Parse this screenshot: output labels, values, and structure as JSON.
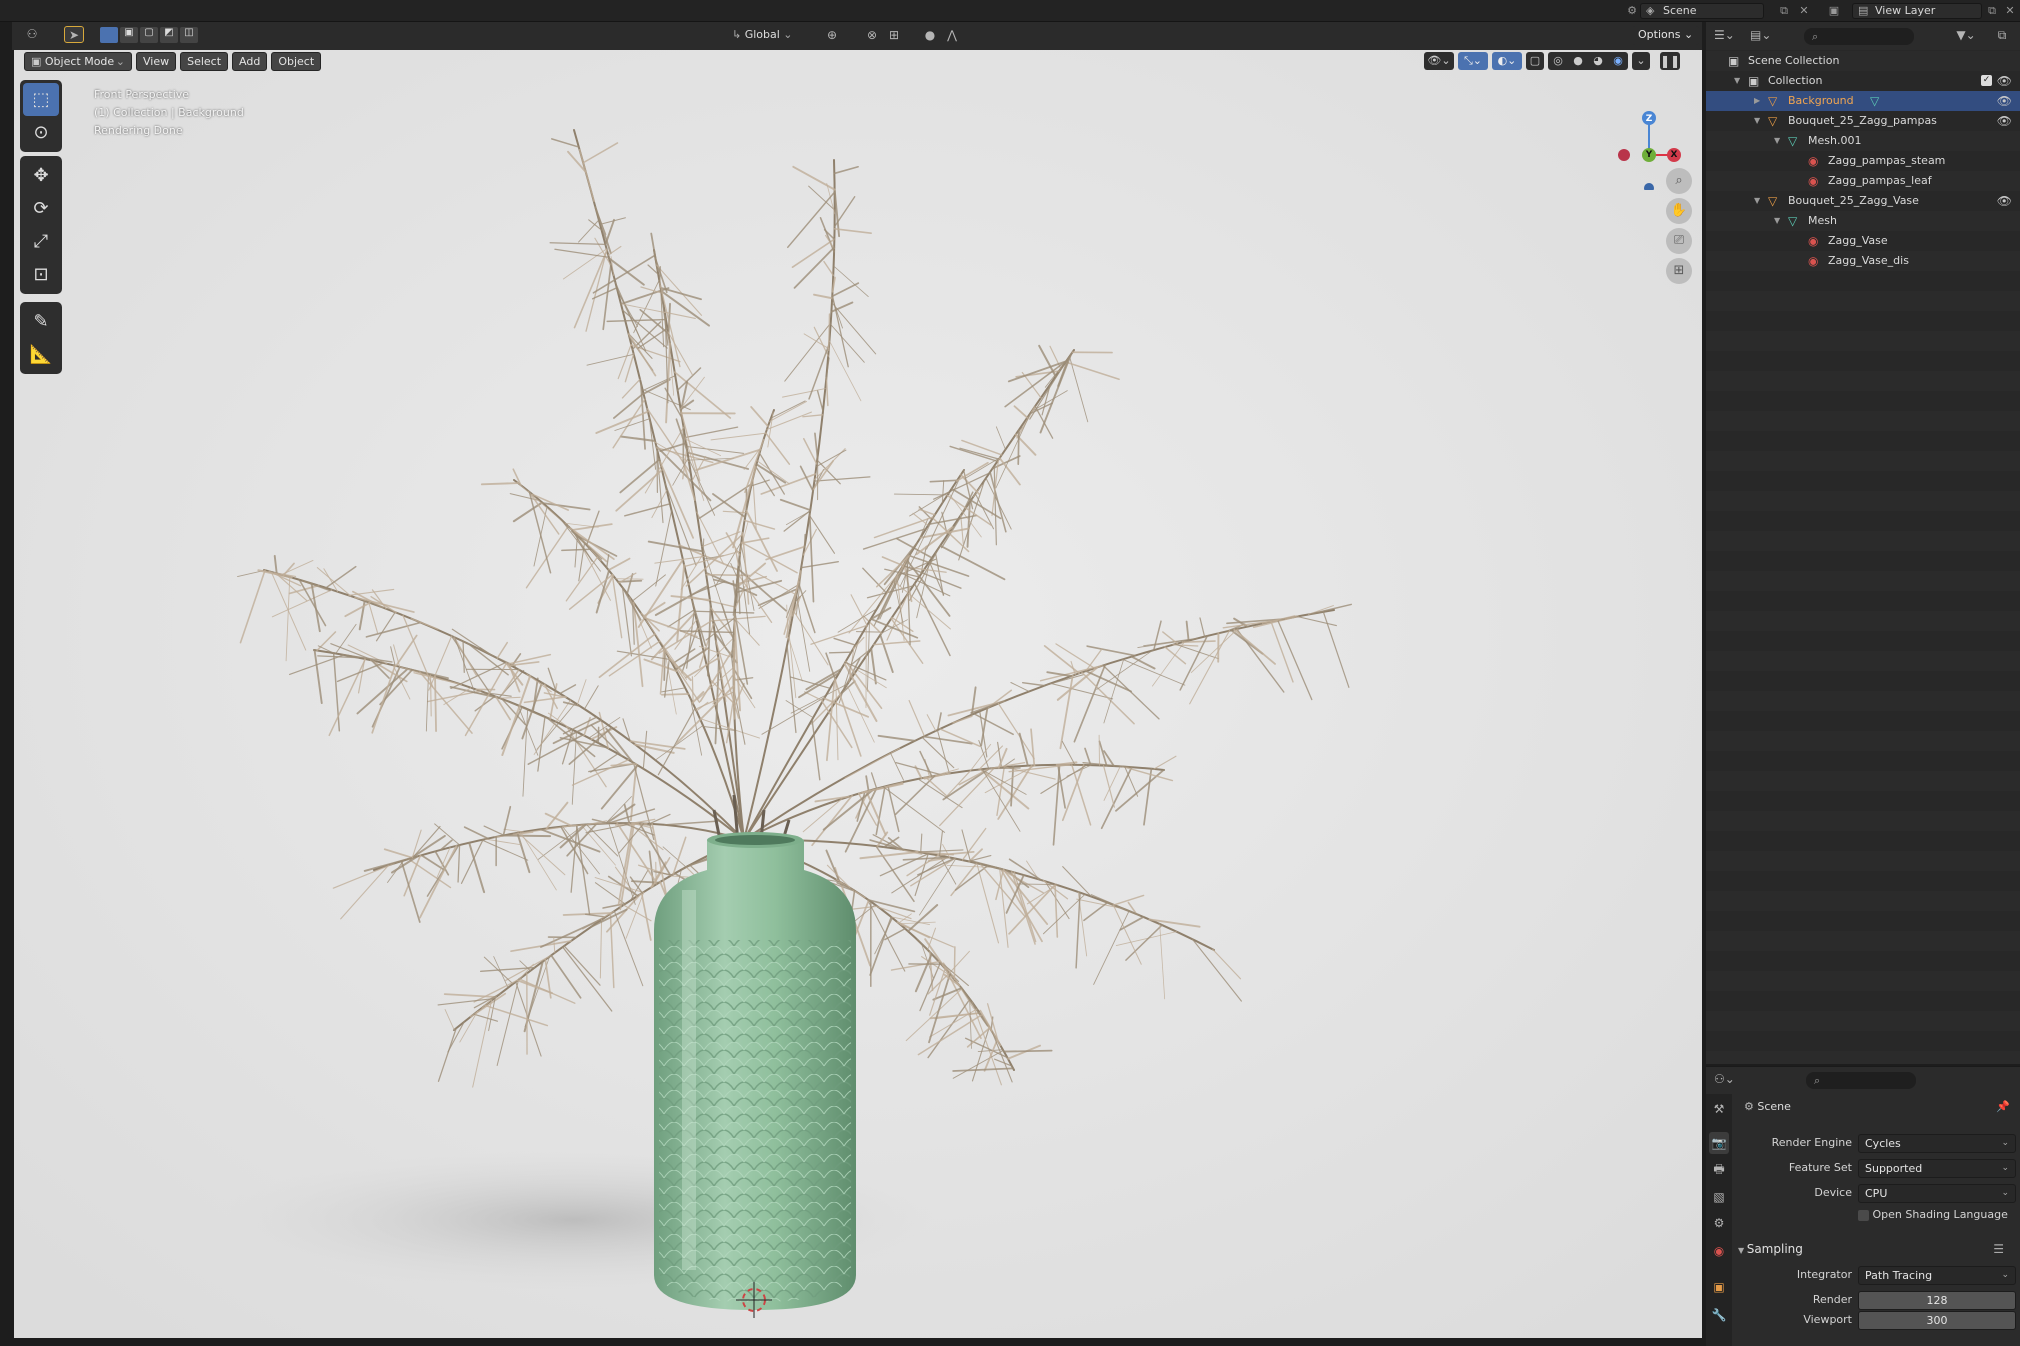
{
  "topbar": {
    "scene_name": "Scene",
    "view_layer_name": "View Layer"
  },
  "viewport_header": {
    "mode": "Object Mode",
    "menus": [
      "View",
      "Select",
      "Add",
      "Object"
    ],
    "transform_orientation": "Global",
    "options_label": "Options"
  },
  "viewport": {
    "overlay_lines": [
      "Front Perspective",
      "(1) Collection | Background",
      "Rendering Done"
    ],
    "gizmo_axes": {
      "z": "Z",
      "y": "Y",
      "x": "X"
    }
  },
  "toolbar": {
    "tools": [
      "select-box",
      "cursor",
      "move",
      "rotate",
      "scale",
      "transform",
      "annotate",
      "measure"
    ]
  },
  "outliner": {
    "root": "Scene Collection",
    "rows": [
      {
        "label": "Collection",
        "type": "collection"
      },
      {
        "label": "Background",
        "type": "object"
      },
      {
        "label": "Bouquet_25_Zagg_pampas",
        "type": "object"
      },
      {
        "label": "Mesh.001",
        "type": "mesh"
      },
      {
        "label": "Zagg_pampas_steam",
        "type": "material"
      },
      {
        "label": "Zagg_pampas_leaf",
        "type": "material"
      },
      {
        "label": "Bouquet_25_Zagg_Vase",
        "type": "object"
      },
      {
        "label": "Mesh",
        "type": "mesh"
      },
      {
        "label": "Zagg_Vase",
        "type": "material"
      },
      {
        "label": "Zagg_Vase_dis",
        "type": "material"
      }
    ]
  },
  "properties": {
    "context": "Scene",
    "render_engine_label": "Render Engine",
    "render_engine": "Cycles",
    "feature_set_label": "Feature Set",
    "feature_set": "Supported",
    "device_label": "Device",
    "device": "CPU",
    "osl_label": "Open Shading Language",
    "sampling_label": "Sampling",
    "integrator_label": "Integrator",
    "integrator": "Path Tracing",
    "render_label": "Render",
    "render_samples": "128",
    "viewport_label": "Viewport",
    "viewport_samples": "300"
  },
  "colors": {
    "accent": "#4b72b0",
    "vase": "#8fbf9c",
    "pampas": "#bfae98",
    "viewport_bg": "#e5e5e5"
  }
}
